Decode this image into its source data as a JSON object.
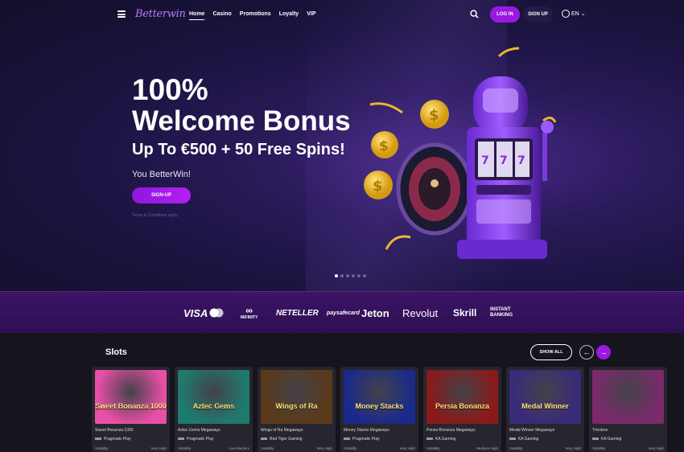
{
  "nav": {
    "logo": "Betterwin",
    "links": [
      "Home",
      "Casino",
      "Promotions",
      "Loyalty",
      "VIP"
    ],
    "login_label": "LOG IN",
    "signup_label": "SIGN UP",
    "language": "EN",
    "icons": [
      "menu-icon",
      "search-icon",
      "globe-icon",
      "chevron-down-icon"
    ]
  },
  "hero": {
    "line1": "100%",
    "line2": "Welcome Bonus",
    "line3": "Up To €500 + 50 Free Spins!",
    "subtitle": "You BetterWin!",
    "cta_label": "SIGN-UP",
    "terms": "Terms & Conditions apply",
    "carousel_slides": 6,
    "active_slide": 1
  },
  "payments": [
    "VISA",
    "MiFINITY",
    "NETELLER",
    "paysafecard",
    "Jeton",
    "Revolut",
    "Skrill",
    "INSTANT BANKING"
  ],
  "slots": {
    "title": "Slots",
    "show_all_label": "SHOW ALL",
    "prev_icon": "arrow-left-icon",
    "next_icon": "arrow-right-icon",
    "volatility_label": "Volatility",
    "games": [
      {
        "name": "Sweet Bonanza 1000",
        "provider": "Pragmatic Play",
        "volatility": "Very High",
        "art": "Sweet Bonanza 1000",
        "color": "#e84fa6"
      },
      {
        "name": "Aztec Gems Megaways",
        "provider": "Pragmatic Play",
        "volatility": "Low-Medium",
        "art": "Aztec Gems",
        "color": "#1f7a6e"
      },
      {
        "name": "Wings of Ra Megaways",
        "provider": "Red Tiger Gaming",
        "volatility": "Very High",
        "art": "Wings of Ra",
        "color": "#5a3a1a"
      },
      {
        "name": "Money Stacks Megaways",
        "provider": "Pragmatic Play",
        "volatility": "Very High",
        "art": "Money Stacks",
        "color": "#1a2a8a"
      },
      {
        "name": "Persia Bonanza Megaways",
        "provider": "KA Gaming",
        "volatility": "Medium-High",
        "art": "Persia Bonanza",
        "color": "#8a1a1a"
      },
      {
        "name": "Medal Winner Megaways",
        "provider": "KA Gaming",
        "volatility": "Very High",
        "art": "Medal Winner",
        "color": "#3a2a7a"
      },
      {
        "name": "Tricolore",
        "provider": "KA Gaming",
        "volatility": "Very High",
        "art": "",
        "color": "#7a2a6a"
      }
    ]
  }
}
